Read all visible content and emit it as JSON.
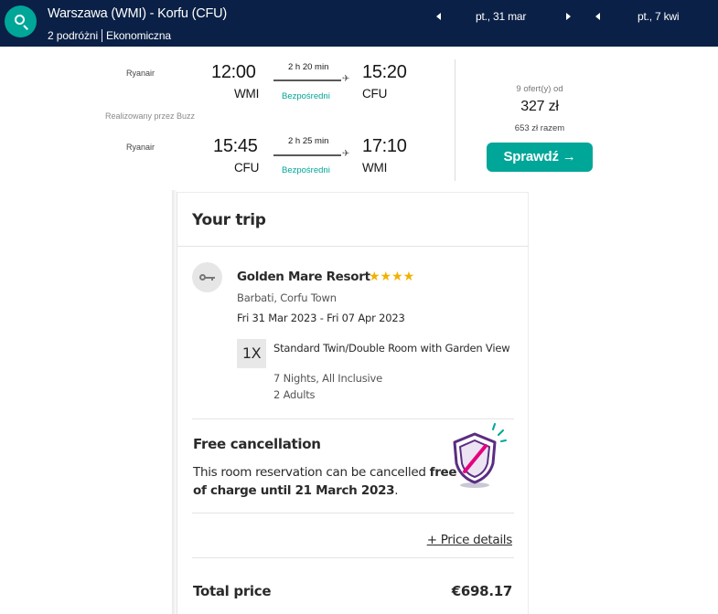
{
  "header": {
    "route": "Warszawa (WMI) - Korfu (CFU)",
    "travellers": "2 podróżni",
    "cabin_class": "Ekonomiczna",
    "depart_date": "pt., 31 mar",
    "return_date": "pt., 7 kwi"
  },
  "flight_card": {
    "outbound": {
      "airline": "Ryanair",
      "depart_time": "12:00",
      "depart_code": "WMI",
      "duration": "2 h 20 min",
      "stops": "Bezpośredni",
      "arrive_time": "15:20",
      "arrive_code": "CFU"
    },
    "operated_by": "Realizowany przez Buzz",
    "inbound": {
      "airline": "Ryanair",
      "depart_time": "15:45",
      "depart_code": "CFU",
      "duration": "2 h 25 min",
      "stops": "Bezpośredni",
      "arrive_time": "17:10",
      "arrive_code": "WMI"
    },
    "offers_label": "9 ofert(y) od",
    "price": "327 zł",
    "total_label": "653 zł razem",
    "check_button": "Sprawdź →"
  },
  "trip": {
    "title": "Your trip",
    "hotel": {
      "name": "Golden Mare Resort",
      "stars": "★★★★",
      "star_count": 4,
      "location": "Barbati, Corfu Town",
      "dates": "Fri 31 Mar 2023 - Fri 07 Apr 2023",
      "room_quantity": "1X",
      "room_name": "Standard Twin/Double Room with Garden View",
      "board": "7 Nights, All Inclusive",
      "guests": "2 Adults"
    },
    "cancellation": {
      "title": "Free cancellation",
      "text_prefix": "This room reservation can be cancelled",
      "text_bold": "free of charge until 21 March 2023",
      "text_suffix": "."
    },
    "price_details_link": "+ Price details",
    "total_label": "Total price",
    "total_value": "€698.17"
  },
  "colors": {
    "header_bg": "#0a2046",
    "accent": "#00a698",
    "star": "#f2b100",
    "shield_purple": "#5b2d82",
    "shield_pink": "#e6007e"
  },
  "icons": {
    "search": "search-icon",
    "plane": "plane-icon",
    "key": "key-icon",
    "shield": "shield-check-icon"
  }
}
